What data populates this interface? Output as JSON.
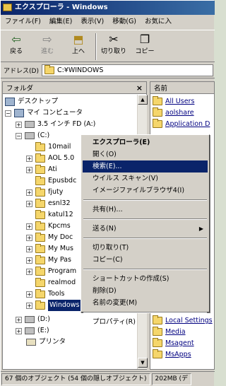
{
  "window": {
    "title": "エクスプローラ - Windows"
  },
  "menubar": [
    "ファイル(F)",
    "編集(E)",
    "表示(V)",
    "移動(G)",
    "お気に入"
  ],
  "toolbar": [
    {
      "label": "戻る",
      "icon": "back-arrow-icon"
    },
    {
      "label": "進む",
      "icon": "forward-arrow-icon"
    },
    {
      "label": "上へ",
      "icon": "up-folder-icon"
    },
    {
      "label": "切り取り",
      "icon": "scissors-icon"
    },
    {
      "label": "コピー",
      "icon": "copy-icon"
    }
  ],
  "address": {
    "label": "アドレス(D)",
    "value": "C:¥WINDOWS"
  },
  "left_pane": {
    "header": "フォルダ",
    "close": "×"
  },
  "tree": [
    {
      "label": "デスクトップ"
    },
    {
      "label": "マイ コンピュータ"
    },
    {
      "label": "3.5 インチ FD (A:)"
    },
    {
      "label": "(C:)"
    },
    {
      "label": "10mail"
    },
    {
      "label": "AOL 5.0"
    },
    {
      "label": "Ati"
    },
    {
      "label": "Epusbdc"
    },
    {
      "label": "fjuty"
    },
    {
      "label": "esnl32"
    },
    {
      "label": "katul12"
    },
    {
      "label": "Kpcms"
    },
    {
      "label": "My Doc"
    },
    {
      "label": "My Mus"
    },
    {
      "label": "My Pas"
    },
    {
      "label": "Program"
    },
    {
      "label": "realmod"
    },
    {
      "label": "Tools"
    },
    {
      "label": "Windows"
    },
    {
      "label": "(D:)"
    },
    {
      "label": "(E:)"
    },
    {
      "label": "プリンタ"
    }
  ],
  "right_pane": {
    "header": "名前",
    "items": [
      "All Users",
      "aolshare",
      "Application D",
      "Local Settings",
      "Media",
      "Msagent",
      "MsApps"
    ]
  },
  "context_menu": [
    {
      "label": "エクスプローラ(E)",
      "bold": true
    },
    {
      "label": "開く(O)"
    },
    {
      "label": "検索(E)...",
      "selected": true
    },
    {
      "label": "ウイルス スキャン(V)"
    },
    {
      "label": "イメージファイルブラウザ4(I)"
    },
    {
      "sep": true
    },
    {
      "label": "共有(H)..."
    },
    {
      "sep": true
    },
    {
      "label": "送る(N)",
      "submenu": true
    },
    {
      "sep": true
    },
    {
      "label": "切り取り(T)"
    },
    {
      "label": "コピー(C)"
    },
    {
      "sep": true
    },
    {
      "label": "ショートカットの作成(S)"
    },
    {
      "label": "削除(D)"
    },
    {
      "label": "名前の変更(M)"
    },
    {
      "sep": true
    },
    {
      "label": "プロパティ(R)"
    }
  ],
  "status": {
    "objects": "67 個のオブジェクト (54 個の隠しオブジェクト)",
    "size": "202MB (デ"
  }
}
